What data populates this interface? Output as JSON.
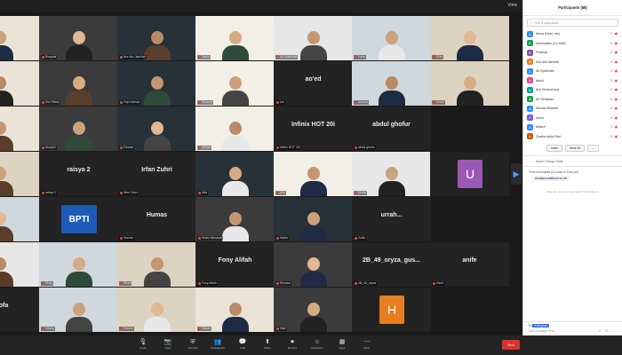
{
  "topbar": {
    "view_label": "View"
  },
  "gallery": {
    "tiles": [
      {
        "label": "Anisa",
        "name": ""
      },
      {
        "label": "Rosyida",
        "name": ""
      },
      {
        "label": "Nur Aini Jamilah",
        "name": ""
      },
      {
        "label": "Tasya",
        "name": ""
      },
      {
        "label": "Ali Syaifullah",
        "name": ""
      },
      {
        "label": "Faira",
        "name": ""
      },
      {
        "label": "Dian",
        "name": ""
      },
      {
        "label": "Nabila",
        "name": ""
      },
      {
        "label": "Dwi Hilma",
        "name": ""
      },
      {
        "label": "Fajri Ahmad",
        "name": ""
      },
      {
        "label": "Khusnul",
        "name": ""
      },
      {
        "label": "Ica",
        "name": "ao'ed"
      },
      {
        "label": "Ahmad",
        "name": ""
      },
      {
        "label": "Uleak",
        "name": ""
      },
      {
        "label": "Rahmi",
        "name": ""
      },
      {
        "label": "Nuryani",
        "name": ""
      },
      {
        "label": "Fauzan",
        "name": ""
      },
      {
        "label": "ahmad",
        "name": ""
      },
      {
        "label": "Infinix HOT 20i",
        "name": "Infinix HOT 20i"
      },
      {
        "label": "abdul ghofur",
        "name": "abdul ghofur"
      },
      {
        "label": "Admin BPTI",
        "name": ""
      },
      {
        "label": "raisya 2",
        "name": "raisya 2"
      },
      {
        "label": "Irfan Zuhri",
        "name": "Irfan Zuhri"
      },
      {
        "label": "Ulfa",
        "name": ""
      },
      {
        "label": "Umi",
        "name": ""
      },
      {
        "label": "Dhafa",
        "name": ""
      },
      {
        "label": "Ummi",
        "name": ""
      },
      {
        "label": "M. Fajar",
        "name": ""
      },
      {
        "label": "Humas",
        "name": "Humas"
      },
      {
        "label": "Husni Mubarak",
        "name": ""
      },
      {
        "label": "Nadia",
        "name": ""
      },
      {
        "label": "Zulfa",
        "name": "urrah..."
      },
      {
        "label": "Lutfi",
        "name": ""
      },
      {
        "label": "Rizky",
        "name": ""
      },
      {
        "label": "Riska",
        "name": ""
      },
      {
        "label": "Fony Alifah",
        "name": "Fony Alifah"
      },
      {
        "label": "Khonsa",
        "name": ""
      },
      {
        "label": "2B_49_oryza",
        "name": "2B_49_oryza_gus..."
      },
      {
        "label": "Hanif",
        "name": "anife"
      },
      {
        "label": "Shofa",
        "name": "Shofa"
      },
      {
        "label": "Gilang",
        "name": ""
      },
      {
        "label": "Farhan",
        "name": ""
      },
      {
        "label": "Hasan",
        "name": ""
      },
      {
        "label": "Hani",
        "name": ""
      },
      {
        "label": "Zabiela Ayu Gira...",
        "name": "Zabiela Ayu Gira..."
      }
    ],
    "bpti_logo": "BPTI",
    "u_avatar": "U",
    "h_avatar": "H"
  },
  "toolbar": {
    "items": [
      {
        "label": "Audio",
        "icon": "mic-icon"
      },
      {
        "label": "Video",
        "icon": "camera-icon"
      },
      {
        "label": "Security",
        "icon": "shield-icon"
      },
      {
        "label": "Participants",
        "icon": "people-icon"
      },
      {
        "label": "Chat",
        "icon": "chat-icon"
      },
      {
        "label": "Share",
        "icon": "share-icon"
      },
      {
        "label": "Record",
        "icon": "record-icon"
      },
      {
        "label": "Reactions",
        "icon": "reactions-icon"
      },
      {
        "label": "Apps",
        "icon": "apps-icon"
      },
      {
        "label": "More",
        "icon": "more-icon"
      }
    ],
    "end_label": "End"
  },
  "panel": {
    "title": "Participants (68)",
    "search_placeholder": "Find a participant",
    "participants": [
      {
        "initial": "A",
        "name": "Anisa (Host, me)",
        "color": "#2d8cff"
      },
      {
        "initial": "K",
        "name": "Informatika (Co-host)",
        "color": "#16a34a"
      },
      {
        "initial": "R",
        "name": "Rosyida",
        "color": "#8e44ad"
      },
      {
        "initial": "N",
        "name": "Nur Aini Jamilah",
        "color": "#e67e22"
      },
      {
        "initial": "A",
        "name": "Ali Syaifullah",
        "color": "#2d8cff"
      },
      {
        "initial": "A",
        "name": "abdul",
        "color": "#e84393"
      },
      {
        "initial": "A",
        "name": "Aini Khoirunnisa",
        "color": "#00a3a3"
      },
      {
        "initial": "A",
        "name": "Ari Setiawan",
        "color": "#16a34a"
      },
      {
        "initial": "A",
        "name": "Ahmad Mustofa",
        "color": "#2d8cff"
      },
      {
        "initial": "A",
        "name": "Aziza",
        "color": "#6c5ce7"
      },
      {
        "initial": "A",
        "name": "Alfarizi",
        "color": "#2d8cff"
      },
      {
        "initial": "A",
        "name": "Zhafira Aulia Putri",
        "color": "#d35400"
      }
    ],
    "invite_label": "Invite",
    "mute_all_label": "Mute All",
    "more_label": "...",
    "chat_title": "Zoom Group Chat",
    "chat_sender": "From Informatika (Co-host) to Everyone",
    "chat_message": "Assalamualaikum wr wb",
    "chat_divider": "Who can see your messages? Recording on",
    "chat_to_prefix": "To:",
    "chat_to_who": "Everyone",
    "chat_input_placeholder": "Type message here...",
    "chat_tools": "☺ ⎘ ⋯"
  }
}
